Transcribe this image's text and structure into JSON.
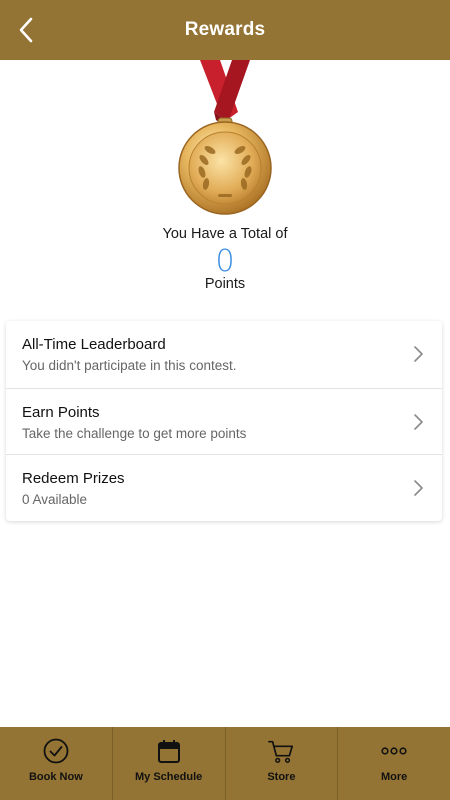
{
  "header": {
    "title": "Rewards",
    "back_icon": "chevron-left-icon"
  },
  "medal": {
    "icon": "gold-medal-icon"
  },
  "points": {
    "caption": "You Have a Total of",
    "value": "0",
    "unit": "Points"
  },
  "list": {
    "items": [
      {
        "title": "All-Time Leaderboard",
        "subtitle": "You didn't participate in this contest."
      },
      {
        "title": "Earn Points",
        "subtitle": "Take the challenge to get more points"
      },
      {
        "title": "Redeem Prizes",
        "subtitle": "0 Available"
      }
    ]
  },
  "tabbar": {
    "tabs": [
      {
        "label": "Book Now",
        "icon": "check-circle-icon"
      },
      {
        "label": "My Schedule",
        "icon": "calendar-icon"
      },
      {
        "label": "Store",
        "icon": "cart-icon"
      },
      {
        "label": "More",
        "icon": "more-dots-icon"
      }
    ]
  },
  "colors": {
    "brand": "#947434",
    "points_value": "#3a8ee0",
    "ribbon": "#c8202c"
  }
}
